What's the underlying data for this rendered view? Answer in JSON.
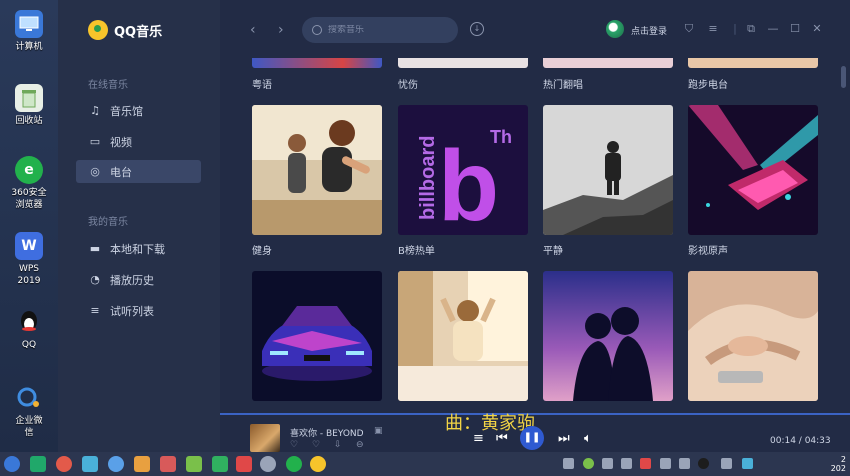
{
  "desktop": {
    "icons": [
      {
        "label": "计算机",
        "icon": "computer-icon",
        "color": "#3a78d8"
      },
      {
        "label": "回收站",
        "icon": "recycle-bin-icon",
        "color": "#6fa85a"
      },
      {
        "label": "360安全\n浏览器",
        "icon": "360-browser-icon",
        "color": "#22b14c"
      },
      {
        "label": "WPS\n2019",
        "icon": "wps-icon",
        "color": "#3f6ee0"
      },
      {
        "label": "QQ",
        "icon": "qq-penguin-icon",
        "color": "#1d1d1d"
      },
      {
        "label": "企业微\n信",
        "icon": "wecom-icon",
        "color": "#3f8de0"
      }
    ]
  },
  "app": {
    "title": "QQ音乐",
    "sidebar": {
      "online_title": "在线音乐",
      "online_items": [
        {
          "label": "音乐馆",
          "icon": "music-note-icon"
        },
        {
          "label": "视频",
          "icon": "video-icon"
        },
        {
          "label": "电台",
          "icon": "radio-icon"
        }
      ],
      "mine_title": "我的音乐",
      "mine_items": [
        {
          "label": "本地和下载",
          "icon": "monitor-icon"
        },
        {
          "label": "播放历史",
          "icon": "clock-icon"
        },
        {
          "label": "试听列表",
          "icon": "playlist-icon"
        }
      ]
    },
    "topbar": {
      "search_placeholder": "搜索音乐",
      "login_label": "点击登录"
    },
    "grid": {
      "top_labels": [
        "粤语",
        "忧伤",
        "热门翻唱",
        "跑步电台"
      ],
      "tiles_row1": [
        {
          "label": "健身",
          "art": "fitness"
        },
        {
          "label": "B榜热单",
          "art": "billboard",
          "art_text": "billboard",
          "art_letter": "b",
          "art_sup": "Th"
        },
        {
          "label": "平静",
          "art": "calm"
        },
        {
          "label": "影视原声",
          "art": "soundtrack"
        }
      ],
      "tiles_row2": [
        {
          "art": "car"
        },
        {
          "art": "bedroom"
        },
        {
          "art": "couple"
        },
        {
          "art": "sleep"
        }
      ]
    },
    "player": {
      "song": "喜欢你 - BEYOND",
      "lyric": "曲：黄家驹",
      "time": "00:14 / 04:33"
    }
  },
  "taskbar": {
    "clock": "2\n202"
  },
  "colors": {
    "accent": "#2f5ad1",
    "lyric": "#f2d445",
    "background": "#222b45"
  }
}
